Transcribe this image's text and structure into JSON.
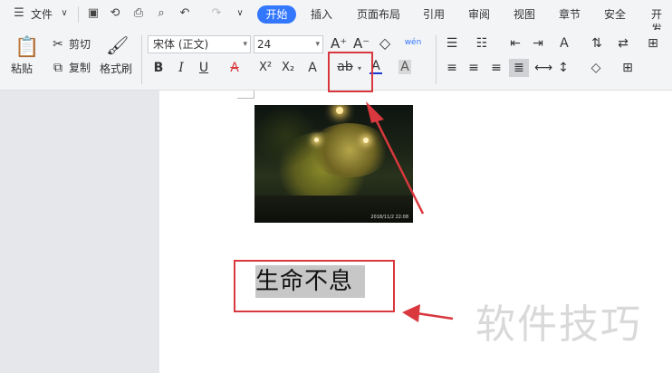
{
  "topbar": {
    "file_label": "文件",
    "tabs": [
      "开始",
      "插入",
      "页面布局",
      "引用",
      "审阅",
      "视图",
      "章节",
      "安全",
      "开发"
    ],
    "active_tab": "开始"
  },
  "ribbon": {
    "paste_label": "粘贴",
    "cut_label": "剪切",
    "copy_label": "复制",
    "format_painter_label": "格式刷",
    "font_name": "宋体 (正文)",
    "font_size": "24",
    "bold": "B",
    "italic": "I",
    "underline": "U",
    "strikethrough": "A",
    "superscript": "X²",
    "subscript": "X₂",
    "text_effect": "A",
    "highlight": "ab",
    "font_color": "A",
    "char_shading": "A",
    "grow": "A⁺",
    "shrink": "A⁻",
    "clear": "◇",
    "phonetic": "wén"
  },
  "document": {
    "photo_timestamp": "2018/11/2 22:08",
    "text": "生命不息"
  },
  "watermark": "软件技巧",
  "colors": {
    "accent": "#3377ff",
    "annotation_red": "#d9383e",
    "highlight_gray": "#c7c7c7"
  }
}
